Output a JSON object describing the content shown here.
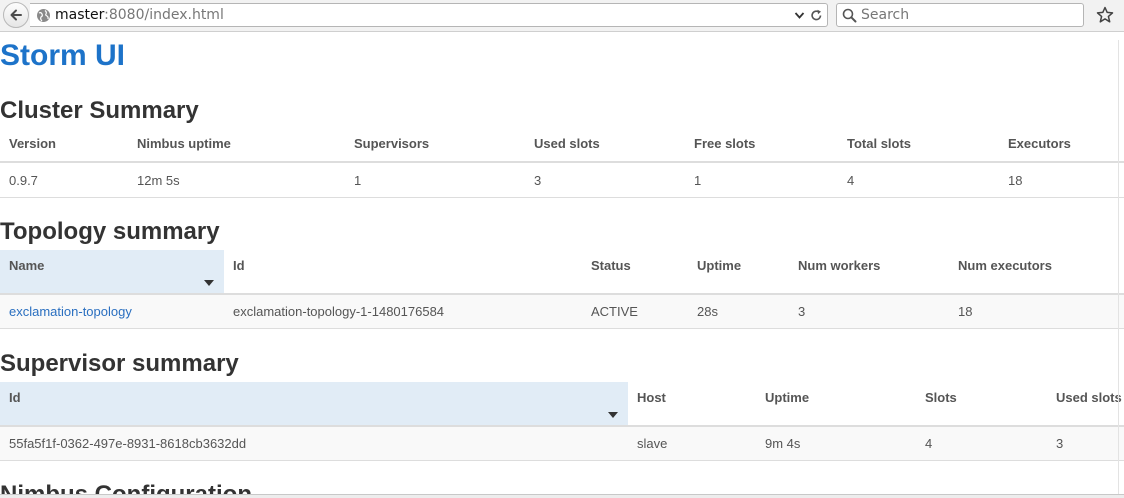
{
  "browser": {
    "url_host": "master",
    "url_rest": ":8080/index.html",
    "search_placeholder": "Search"
  },
  "page": {
    "title": "Storm UI"
  },
  "cluster_summary": {
    "title": "Cluster Summary",
    "columns": [
      "Version",
      "Nimbus uptime",
      "Supervisors",
      "Used slots",
      "Free slots",
      "Total slots",
      "Executors"
    ],
    "row": [
      "0.9.7",
      "12m 5s",
      "1",
      "3",
      "1",
      "4",
      "18"
    ]
  },
  "topology_summary": {
    "title": "Topology summary",
    "columns": [
      "Name",
      "Id",
      "Status",
      "Uptime",
      "Num workers",
      "Num executors"
    ],
    "row": [
      "exclamation-topology",
      "exclamation-topology-1-1480176584",
      "ACTIVE",
      "28s",
      "3",
      "18"
    ]
  },
  "supervisor_summary": {
    "title": "Supervisor summary",
    "columns": [
      "Id",
      "Host",
      "Uptime",
      "Slots",
      "Used slots"
    ],
    "row": [
      "55fa5f1f-0362-497e-8931-8618cb3632dd",
      "slave",
      "9m 4s",
      "4",
      "3"
    ]
  },
  "nimbus_configuration": {
    "title": "Nimbus Configuration"
  },
  "colors": {
    "accent": "#1d73c9",
    "link": "#2a6fc0",
    "sorted_header": "#e1ecf6"
  }
}
